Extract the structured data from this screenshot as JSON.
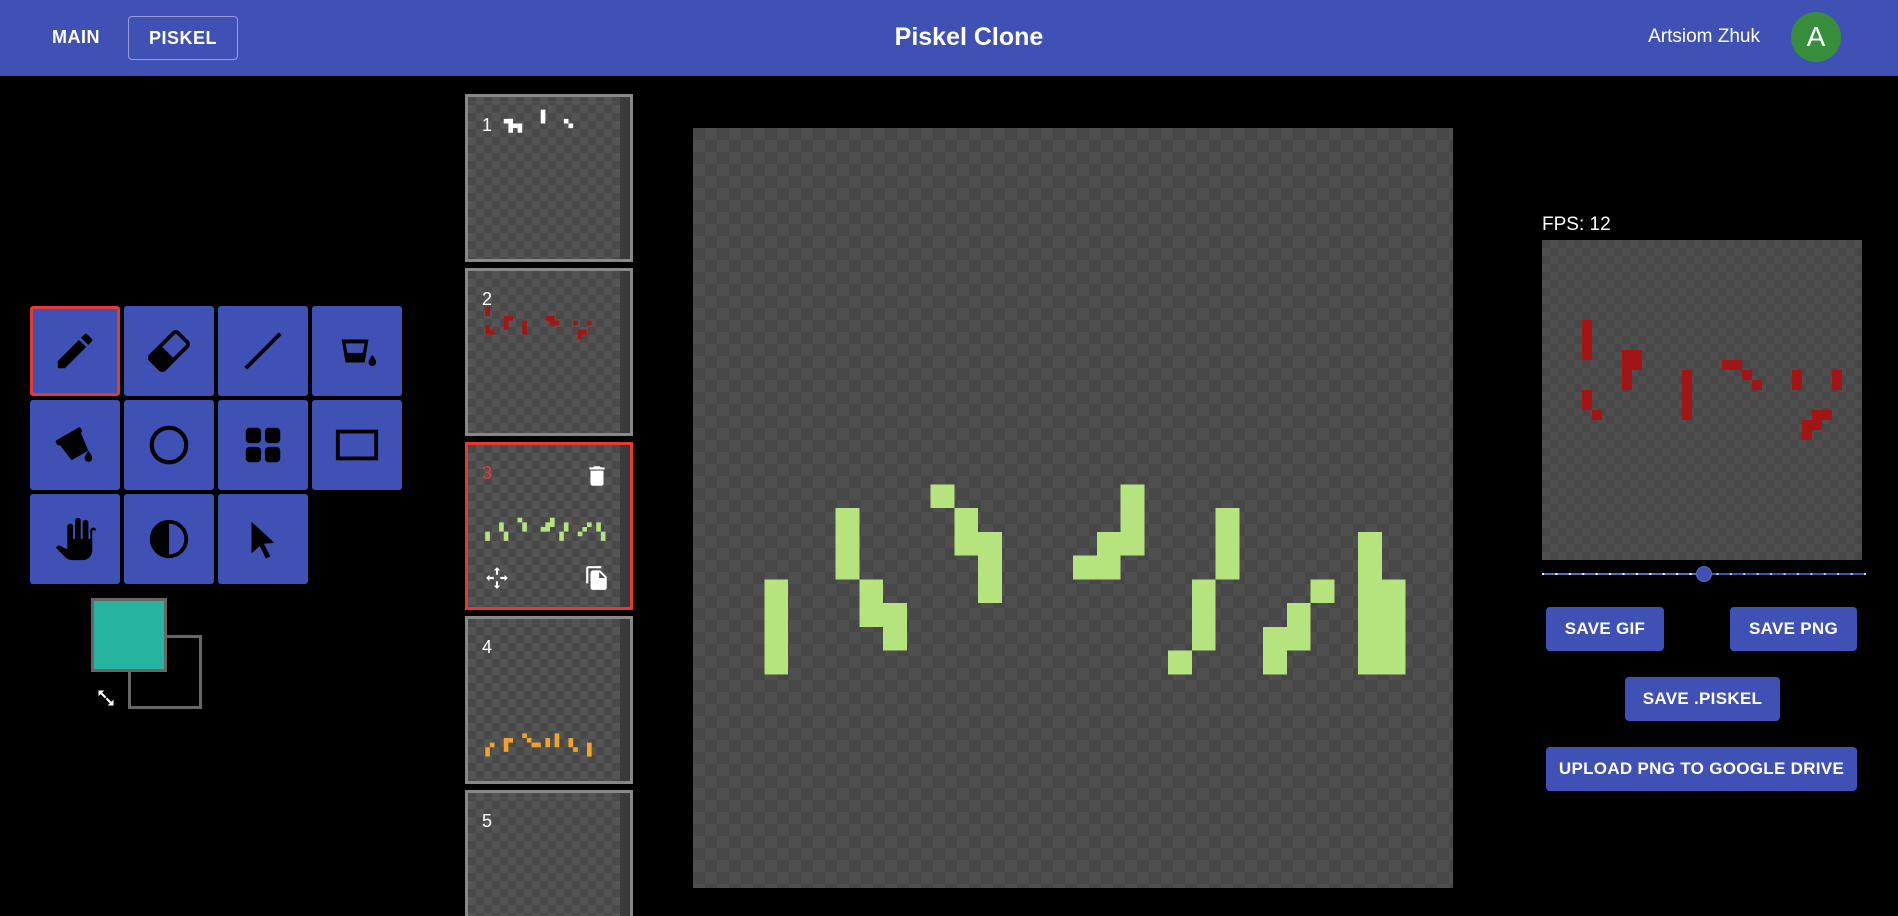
{
  "header": {
    "nav": [
      {
        "label": "MAIN"
      },
      {
        "label": "PISKEL"
      }
    ],
    "title": "Piskel Clone",
    "user_name": "Artsiom Zhuk",
    "avatar_initial": "A"
  },
  "tools": [
    {
      "icon": "pencil-icon",
      "active": true
    },
    {
      "icon": "eraser-icon",
      "active": false
    },
    {
      "icon": "line-icon",
      "active": false
    },
    {
      "icon": "paint-bucket-icon",
      "active": false
    },
    {
      "icon": "paint-all-bucket-icon",
      "active": false
    },
    {
      "icon": "circle-icon",
      "active": false
    },
    {
      "icon": "grid-icon",
      "active": false
    },
    {
      "icon": "rectangle-icon",
      "active": false
    },
    {
      "icon": "hand-icon",
      "active": false
    },
    {
      "icon": "lighten-darken-icon",
      "active": false
    },
    {
      "icon": "cursor-icon",
      "active": false
    }
  ],
  "colors": {
    "primary": "#26b3a0",
    "secondary": "#000000",
    "accent": "#3f51b5",
    "active_border": "#e53935"
  },
  "frames": [
    {
      "number": "1",
      "color": "#ffffff",
      "active": false
    },
    {
      "number": "2",
      "color": "#a31515",
      "active": false
    },
    {
      "number": "3",
      "color": "#b5e37d",
      "active": true
    },
    {
      "number": "4",
      "color": "#f4a424",
      "active": false
    },
    {
      "number": "5",
      "color": "",
      "active": false
    }
  ],
  "preview": {
    "fps_label": "FPS: 12",
    "fps": 12,
    "fps_max": 24
  },
  "buttons": {
    "save_gif": "SAVE GIF",
    "save_png": "SAVE PNG",
    "save_piskel": "SAVE .PISKEL",
    "upload_drive": "UPLOAD PNG TO GOOGLE DRIVE"
  }
}
